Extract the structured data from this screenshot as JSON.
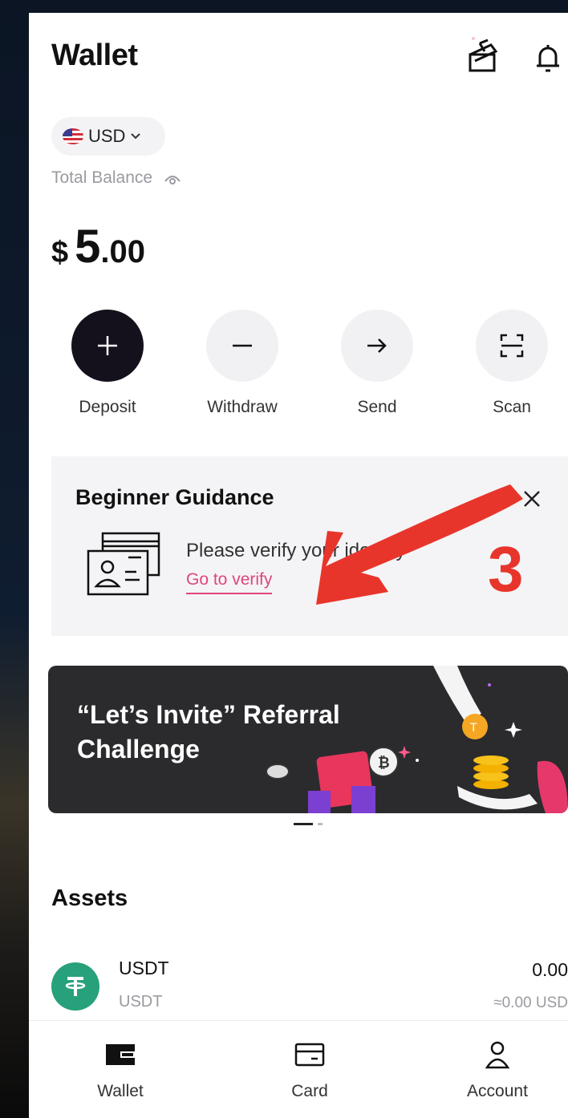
{
  "header": {
    "title": "Wallet"
  },
  "currency": {
    "label": "USD"
  },
  "balance": {
    "label": "Total Balance",
    "symbol": "$",
    "integer": "5",
    "decimal": ".00"
  },
  "actions": [
    {
      "label": "Deposit"
    },
    {
      "label": "Withdraw"
    },
    {
      "label": "Send"
    },
    {
      "label": "Scan"
    }
  ],
  "guidance": {
    "title": "Beginner Guidance",
    "text": "Please verify your identity",
    "link": "Go to verify"
  },
  "annotation": {
    "step": "3",
    "color": "#e8352b"
  },
  "banner": {
    "title_line1": "“Let’s Invite” Referral",
    "title_line2": "Challenge"
  },
  "assets": {
    "heading": "Assets",
    "items": [
      {
        "name": "USDT",
        "sub": "USDT",
        "amount": "0.00",
        "usd": "≈0.00 USD"
      }
    ]
  },
  "nav": [
    {
      "label": "Wallet"
    },
    {
      "label": "Card"
    },
    {
      "label": "Account"
    }
  ],
  "colors": {
    "accent_link": "#e0457b",
    "coin_usdt": "#26a17b",
    "dark_button": "#15111c"
  }
}
